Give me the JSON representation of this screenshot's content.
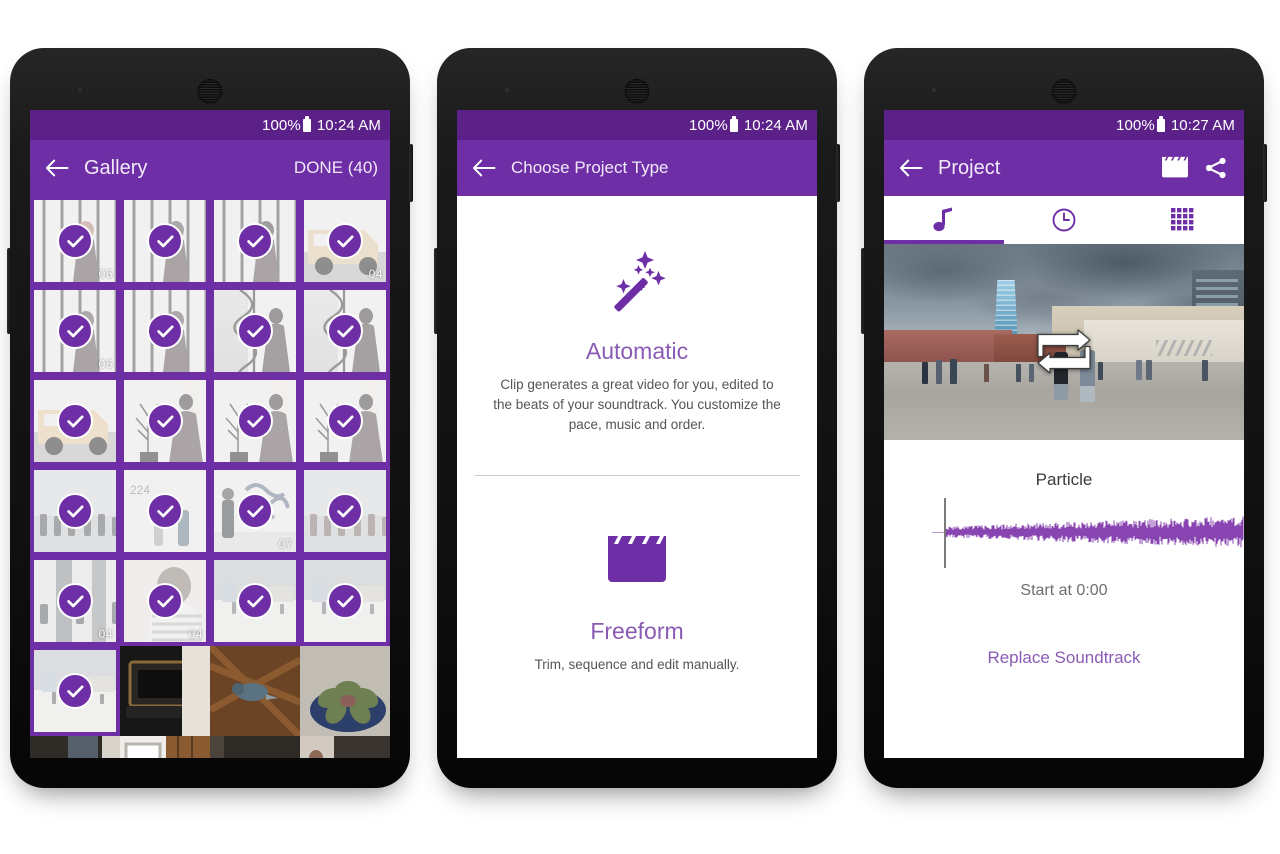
{
  "theme": {
    "accent": "#6e2fa6",
    "accent_light": "#8a5bb5",
    "statusbar": "#5c2189"
  },
  "phones": [
    {
      "id": "gallery",
      "statusbar": {
        "battery": "100%",
        "time": "10:24 AM",
        "battery_icon": "battery-full-icon"
      },
      "appbar": {
        "back_icon": "back-arrow-icon",
        "title": "Gallery",
        "action": "DONE (40)"
      },
      "gallery": {
        "rows": [
          [
            {
              "selected": true,
              "num": "06",
              "scene": "cage-orange-hair"
            },
            {
              "selected": true,
              "num": "",
              "scene": "cage-woman-swing"
            },
            {
              "selected": true,
              "num": "",
              "scene": "cage-woman-stand"
            },
            {
              "selected": true,
              "num": "04",
              "scene": "yellow-car"
            }
          ],
          [
            {
              "selected": true,
              "num": "06",
              "scene": "cage-arms-out"
            },
            {
              "selected": true,
              "num": "",
              "scene": "cage-arms-out2"
            },
            {
              "selected": true,
              "num": "",
              "scene": "spiral-stair"
            },
            {
              "selected": true,
              "num": "",
              "scene": "spiral-stair2"
            }
          ],
          [
            {
              "selected": true,
              "num": "",
              "scene": "yellow-car-close"
            },
            {
              "selected": true,
              "num": "",
              "scene": "tree-planter"
            },
            {
              "selected": true,
              "num": "",
              "scene": "tree-planter2"
            },
            {
              "selected": true,
              "num": "",
              "scene": "tree-planter3"
            }
          ],
          [
            {
              "selected": true,
              "num": "",
              "scene": "street-crowd"
            },
            {
              "selected": true,
              "num": "",
              "scene": "door-224"
            },
            {
              "selected": true,
              "num": "07",
              "scene": "blue-graffiti"
            },
            {
              "selected": true,
              "num": "",
              "scene": "pink-wall-street"
            }
          ],
          [
            {
              "selected": true,
              "num": "04",
              "scene": "pillar-crowd"
            },
            {
              "selected": true,
              "num": "04",
              "scene": "girl-stripes"
            },
            {
              "selected": true,
              "num": "",
              "scene": "plaza-wide"
            },
            {
              "selected": true,
              "num": "",
              "scene": "plaza-wide2"
            }
          ],
          [
            {
              "selected": true,
              "num": "",
              "scene": "plaza-people"
            },
            {
              "selected": false,
              "num": "",
              "scene": "wood-stove"
            },
            {
              "selected": false,
              "num": "",
              "scene": "bird-ceiling"
            },
            {
              "selected": false,
              "num": "",
              "scene": "succulent"
            }
          ],
          [
            {
              "selected": false,
              "num": "",
              "scene": "dark-door"
            },
            {
              "selected": false,
              "num": "",
              "scene": "window-wood"
            },
            {
              "selected": false,
              "num": "",
              "scene": "stairs"
            },
            {
              "selected": false,
              "num": "",
              "scene": "person-steps"
            }
          ]
        ]
      }
    },
    {
      "id": "project-type",
      "statusbar": {
        "battery": "100%",
        "time": "10:24 AM",
        "battery_icon": "battery-full-icon"
      },
      "appbar": {
        "back_icon": "back-arrow-icon",
        "title": "Choose Project Type"
      },
      "options": [
        {
          "icon": "magic-wand-icon",
          "title": "Automatic",
          "description": "Clip generates a great video for you, edited to the beats of your soundtrack. You customize the pace, music and order."
        },
        {
          "icon": "clapperboard-icon",
          "title": "Freeform",
          "description": "Trim, sequence and edit manually."
        }
      ]
    },
    {
      "id": "project",
      "statusbar": {
        "battery": "100%",
        "time": "10:27 AM",
        "battery_icon": "battery-full-icon"
      },
      "appbar": {
        "back_icon": "back-arrow-icon",
        "title": "Project",
        "actions": [
          {
            "icon": "clapperboard-icon",
            "name": "preview-movie-button"
          },
          {
            "icon": "share-icon",
            "name": "share-button"
          }
        ]
      },
      "tabs": [
        {
          "icon": "music-note-icon",
          "name": "tab-soundtrack",
          "active": true
        },
        {
          "icon": "clock-icon",
          "name": "tab-timing",
          "active": false
        },
        {
          "icon": "grid-icon",
          "name": "tab-clips",
          "active": false
        }
      ],
      "preview": {
        "overlay_icon": "swap-arrows-icon",
        "scene": "urban-lot-crowd"
      },
      "soundtrack": {
        "track_name": "Particle",
        "start_label": "Start at 0:00",
        "replace_label": "Replace Soundtrack",
        "waveform_color": "#7b2fa8"
      }
    }
  ]
}
